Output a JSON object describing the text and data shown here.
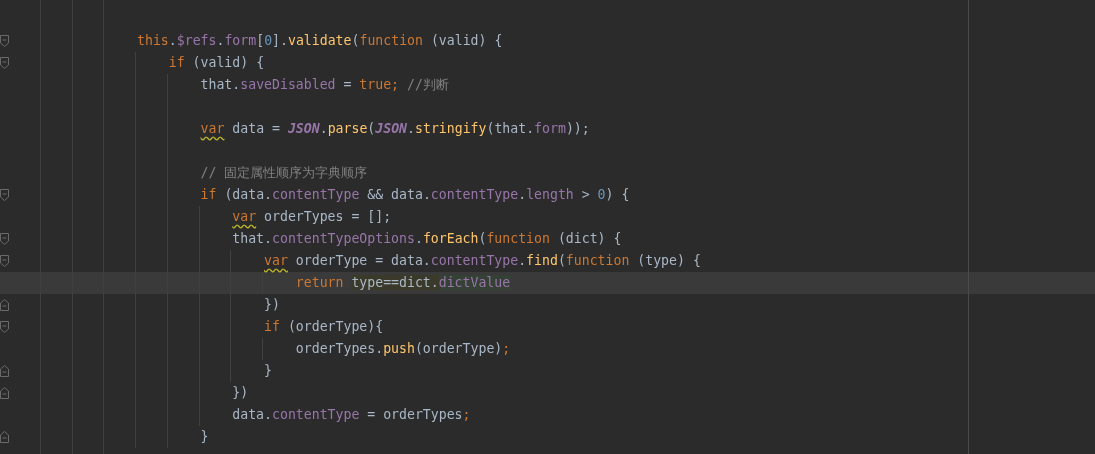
{
  "editor": {
    "lines": [
      {
        "kind": "blank"
      },
      {
        "tokens": [
          {
            "t": "this",
            "kind": "keyword"
          },
          {
            "t": ".",
            "kind": "plain"
          },
          {
            "t": "$refs",
            "kind": "field"
          },
          {
            "t": ".",
            "kind": "plain"
          },
          {
            "t": "form",
            "kind": "field"
          },
          {
            "t": "[",
            "kind": "plain"
          },
          {
            "t": "0",
            "kind": "number"
          },
          {
            "t": "].",
            "kind": "plain"
          },
          {
            "t": "validate",
            "kind": "function"
          },
          {
            "t": "(",
            "kind": "plain"
          },
          {
            "t": "function",
            "kind": "keyword"
          },
          {
            "t": " (valid) {",
            "kind": "plain"
          }
        ],
        "children": [
          {
            "tokens": [
              {
                "t": "if",
                "kind": "keyword"
              },
              {
                "t": " (valid) {",
                "kind": "plain"
              }
            ],
            "children": [
              {
                "tokens": [
                  {
                    "t": "that.",
                    "kind": "plain"
                  },
                  {
                    "t": "saveDisabled",
                    "kind": "field"
                  },
                  {
                    "t": " = ",
                    "kind": "plain"
                  },
                  {
                    "t": "true;",
                    "kind": "keyword"
                  },
                  {
                    "t": " //判断",
                    "kind": "comment"
                  }
                ]
              },
              {
                "kind": "blank"
              },
              {
                "tokens": [
                  {
                    "t": "var",
                    "kind": "keyword",
                    "warning": true
                  },
                  {
                    "t": " data = ",
                    "kind": "plain"
                  },
                  {
                    "t": "JSON",
                    "kind": "global"
                  },
                  {
                    "t": ".",
                    "kind": "plain"
                  },
                  {
                    "t": "parse",
                    "kind": "function"
                  },
                  {
                    "t": "(",
                    "kind": "plain"
                  },
                  {
                    "t": "JSON",
                    "kind": "global"
                  },
                  {
                    "t": ".",
                    "kind": "plain"
                  },
                  {
                    "t": "stringify",
                    "kind": "function"
                  },
                  {
                    "t": "(that.",
                    "kind": "plain"
                  },
                  {
                    "t": "form",
                    "kind": "field"
                  },
                  {
                    "t": "));",
                    "kind": "plain"
                  }
                ]
              },
              {
                "kind": "blank"
              },
              {
                "tokens": [
                  {
                    "t": "// 固定属性顺序为字典顺序",
                    "kind": "comment"
                  }
                ]
              },
              {
                "tokens": [
                  {
                    "t": "if",
                    "kind": "keyword"
                  },
                  {
                    "t": " (data.",
                    "kind": "plain"
                  },
                  {
                    "t": "contentType",
                    "kind": "field"
                  },
                  {
                    "t": " && data.",
                    "kind": "plain"
                  },
                  {
                    "t": "contentType",
                    "kind": "field"
                  },
                  {
                    "t": ".",
                    "kind": "plain"
                  },
                  {
                    "t": "length",
                    "kind": "field"
                  },
                  {
                    "t": " > ",
                    "kind": "plain"
                  },
                  {
                    "t": "0",
                    "kind": "number"
                  },
                  {
                    "t": ") {",
                    "kind": "plain"
                  }
                ],
                "children": [
                  {
                    "tokens": [
                      {
                        "t": "var",
                        "kind": "keyword",
                        "warning": true
                      },
                      {
                        "t": " orderTypes = [];",
                        "kind": "plain"
                      }
                    ]
                  },
                  {
                    "tokens": [
                      {
                        "t": "that.",
                        "kind": "plain"
                      },
                      {
                        "t": "contentTypeOptions",
                        "kind": "field"
                      },
                      {
                        "t": ".",
                        "kind": "plain"
                      },
                      {
                        "t": "forEach",
                        "kind": "function"
                      },
                      {
                        "t": "(",
                        "kind": "plain"
                      },
                      {
                        "t": "function",
                        "kind": "keyword"
                      },
                      {
                        "t": " (dict) {",
                        "kind": "plain"
                      }
                    ],
                    "children": [
                      {
                        "tokens": [
                          {
                            "t": "var",
                            "kind": "keyword",
                            "warning": true
                          },
                          {
                            "t": " orderType = data.",
                            "kind": "plain"
                          },
                          {
                            "t": "contentType",
                            "kind": "field"
                          },
                          {
                            "t": ".",
                            "kind": "plain"
                          },
                          {
                            "t": "find",
                            "kind": "function"
                          },
                          {
                            "t": "(",
                            "kind": "plain"
                          },
                          {
                            "t": "function",
                            "kind": "keyword"
                          },
                          {
                            "t": " (type) {",
                            "kind": "plain"
                          }
                        ],
                        "children": [
                          {
                            "current": true,
                            "tokens": [
                              {
                                "t": "return ",
                                "kind": "keyword"
                              },
                              {
                                "t": "type==dict.",
                                "kind": "plain",
                                "color": "#3b3a2a"
                              },
                              {
                                "t": "dictValue",
                                "kind": "field",
                                "color": "#344134"
                              }
                            ]
                          }
                        ],
                        "close": {
                          "tokens": [
                            {
                              "t": "})",
                              "kind": "plain"
                            }
                          ]
                        }
                      },
                      {
                        "tokens": [
                          {
                            "t": "if",
                            "kind": "keyword"
                          },
                          {
                            "t": " (orderType){",
                            "kind": "plain"
                          }
                        ],
                        "children": [
                          {
                            "tokens": [
                              {
                                "t": "orderTypes.",
                                "kind": "plain"
                              },
                              {
                                "t": "push",
                                "kind": "function"
                              },
                              {
                                "t": "(orderType)",
                                "kind": "plain"
                              },
                              {
                                "t": ";",
                                "kind": "keyword"
                              }
                            ]
                          }
                        ],
                        "close": {
                          "tokens": [
                            {
                              "t": "}",
                              "kind": "plain"
                            }
                          ]
                        }
                      }
                    ],
                    "close": {
                      "tokens": [
                        {
                          "t": "})",
                          "kind": "plain"
                        }
                      ]
                    }
                  },
                  {
                    "tokens": [
                      {
                        "t": "data.",
                        "kind": "plain"
                      },
                      {
                        "t": "contentType",
                        "kind": "field"
                      },
                      {
                        "t": " = orderTypes",
                        "kind": "plain"
                      },
                      {
                        "t": ";",
                        "kind": "keyword"
                      }
                    ]
                  }
                ],
                "close": {
                  "tokens": [
                    {
                      "t": "}",
                      "kind": "plain"
                    }
                  ]
                }
              }
            ]
          }
        ]
      }
    ]
  }
}
